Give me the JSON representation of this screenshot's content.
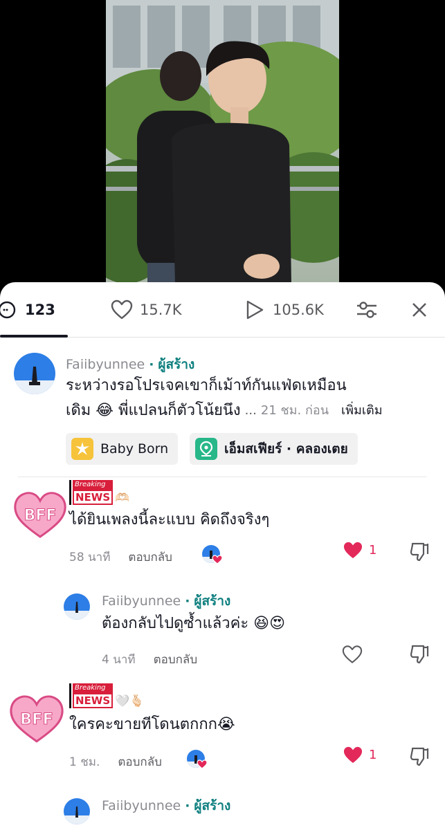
{
  "stats": {
    "comments": "123",
    "likes": "15.7K",
    "views": "105.6K"
  },
  "icons": {
    "comment": "comment-bubble-icon",
    "like": "heart-outline-icon",
    "views": "play-outline-icon",
    "filter": "sliders-icon",
    "close": "close-icon"
  },
  "colors": {
    "creator": "#0f7f7f",
    "like_active": "#e3285a",
    "news_red": "#d81e3a",
    "bff_pink": "#f7a8c8"
  },
  "caption": {
    "author": "Faiibyunnee",
    "creator_label": "ผู้สร้าง",
    "line1": "ระหว่างรอโปรเจคเขาก็เม้าท์กันแฟ่ดเหมือน",
    "line2_text": "เดิม 😂 พี่แปลนก็ตัวโน้ยนึง",
    "line2_ellipsis": "...",
    "time": "21 ชม. ก่อน",
    "see_more": "เพิ่มเติม",
    "chips": [
      {
        "label": "Baby Born",
        "icon": "sparkle-burst-icon"
      },
      {
        "label": "เอ็มสเฟียร์ · คลองเตย",
        "icon": "location-pin-icon"
      }
    ]
  },
  "comments": [
    {
      "badge_top": "Breaking",
      "badge_main": "NEWS",
      "avatar_text": "BFF",
      "emoji": "🫶🏻",
      "text": "ได้ยินเพลงนี้ละแบบ คิดถึงจริงๆ",
      "time": "58 นาที",
      "reply": "ตอบกลับ",
      "likes": "1",
      "reply_item": {
        "author": "Faiibyunnee",
        "creator_label": "ผู้สร้าง",
        "text": "ต้องกลับไปดูซ้ำแล้วค่ะ 😆😍",
        "time": "4 นาที",
        "reply": "ตอบกลับ"
      }
    },
    {
      "badge_top": "Breaking",
      "badge_main": "NEWS",
      "avatar_text": "BFF",
      "emoji": "🤍🫰🏻",
      "text": "ใครคะขายทีโดนตกกก😭",
      "time": "1 ชม.",
      "reply": "ตอบกลับ",
      "likes": "1",
      "reply_item": {
        "author": "Faiibyunnee",
        "creator_label": "ผู้สร้าง"
      }
    }
  ]
}
